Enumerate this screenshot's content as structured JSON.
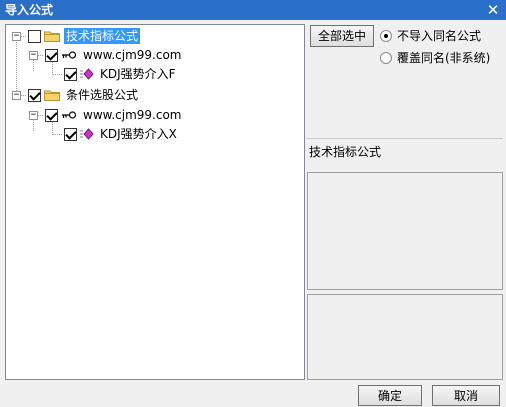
{
  "window": {
    "title": "导入公式",
    "close_glyph": "✕"
  },
  "tree": {
    "nodes": [
      {
        "label": "技术指标公式",
        "checked": false,
        "selected": true,
        "icon": "folder-icon",
        "expander": "−"
      },
      {
        "label": "www.cjm99.com",
        "checked": true,
        "selected": false,
        "icon": "key-icon",
        "expander": "−"
      },
      {
        "label": "KDJ强势介入F",
        "checked": true,
        "selected": false,
        "icon": "formula-icon"
      },
      {
        "label": "条件选股公式",
        "checked": true,
        "selected": false,
        "icon": "folder-icon",
        "expander": "−"
      },
      {
        "label": "www.cjm99.com",
        "checked": true,
        "selected": false,
        "icon": "key-icon",
        "expander": "−"
      },
      {
        "label": "KDJ强势介入X",
        "checked": true,
        "selected": false,
        "icon": "formula-icon"
      }
    ]
  },
  "controls": {
    "select_all_label": "全部选中",
    "radio_no_import": "不导入同名公式",
    "radio_overwrite": "覆盖同名(非系统)",
    "selected_option": "不导入同名公式"
  },
  "info": {
    "category_label": "技术指标公式"
  },
  "footer": {
    "ok_label": "确定",
    "cancel_label": "取消"
  },
  "colors": {
    "titlebar": "#2a6fc9",
    "selection": "#3399ff",
    "folder": "#f5d36b",
    "formula": "#cc33cc"
  }
}
